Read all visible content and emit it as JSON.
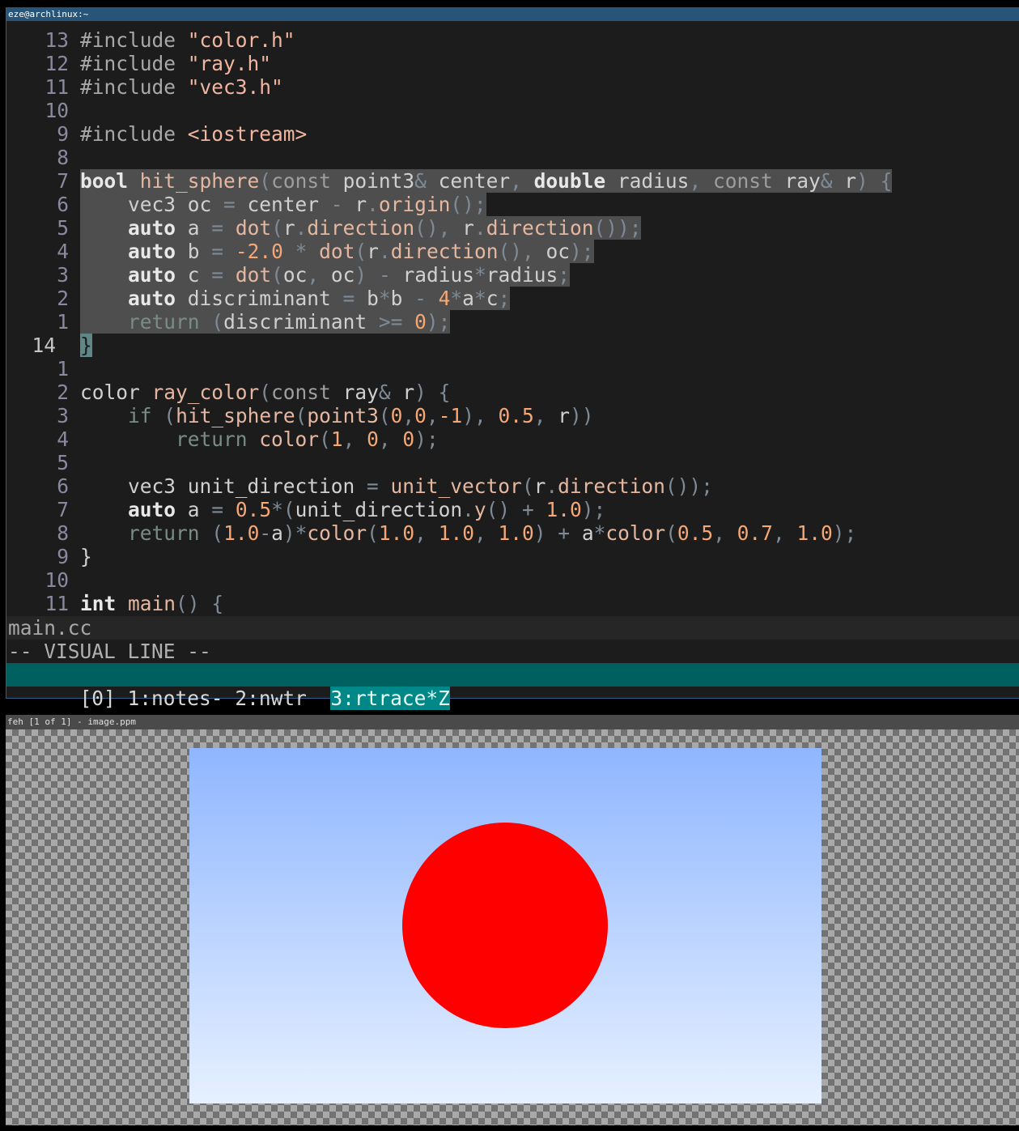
{
  "terminal": {
    "title": "eze@archlinux:~",
    "lines": [
      {
        "n": "13",
        "parts": [
          [
            "pp",
            "#include "
          ],
          [
            "st",
            "\"color.h\""
          ]
        ]
      },
      {
        "n": "12",
        "parts": [
          [
            "pp",
            "#include "
          ],
          [
            "st",
            "\"ray.h\""
          ]
        ]
      },
      {
        "n": "11",
        "parts": [
          [
            "pp",
            "#include "
          ],
          [
            "st",
            "\"vec3.h\""
          ]
        ]
      },
      {
        "n": "10",
        "parts": []
      },
      {
        "n": "9",
        "parts": [
          [
            "pp",
            "#include "
          ],
          [
            "st",
            "<iostream>"
          ]
        ]
      },
      {
        "n": "8",
        "parts": []
      },
      {
        "n": "7",
        "sel": true,
        "parts": [
          [
            "kw",
            "bool"
          ],
          [
            "txt",
            " "
          ],
          [
            "fn",
            "hit_sphere"
          ],
          [
            "op",
            "("
          ],
          [
            "ty",
            "const"
          ],
          [
            "txt",
            " point3"
          ],
          [
            "op",
            "&"
          ],
          [
            "txt",
            " center"
          ],
          [
            "op",
            ","
          ],
          [
            "txt",
            " "
          ],
          [
            "kw",
            "double"
          ],
          [
            "txt",
            " radius"
          ],
          [
            "op",
            ","
          ],
          [
            "txt",
            " "
          ],
          [
            "ty",
            "const"
          ],
          [
            "txt",
            " ray"
          ],
          [
            "op",
            "&"
          ],
          [
            "txt",
            " r"
          ],
          [
            "op",
            ")"
          ],
          [
            "txt",
            " "
          ],
          [
            "op",
            "{"
          ]
        ]
      },
      {
        "n": "6",
        "sel": true,
        "parts": [
          [
            "txt",
            "    vec3 oc "
          ],
          [
            "op",
            "="
          ],
          [
            "txt",
            " center "
          ],
          [
            "op",
            "-"
          ],
          [
            "txt",
            " r"
          ],
          [
            "op",
            "."
          ],
          [
            "fn",
            "origin"
          ],
          [
            "op",
            "();"
          ]
        ]
      },
      {
        "n": "5",
        "sel": true,
        "parts": [
          [
            "txt",
            "    "
          ],
          [
            "kw",
            "auto"
          ],
          [
            "txt",
            " a "
          ],
          [
            "op",
            "="
          ],
          [
            "txt",
            " "
          ],
          [
            "fn",
            "dot"
          ],
          [
            "op",
            "("
          ],
          [
            "txt",
            "r"
          ],
          [
            "op",
            "."
          ],
          [
            "fn",
            "direction"
          ],
          [
            "op",
            "(),"
          ],
          [
            "txt",
            " r"
          ],
          [
            "op",
            "."
          ],
          [
            "fn",
            "direction"
          ],
          [
            "op",
            "());"
          ]
        ]
      },
      {
        "n": "4",
        "sel": true,
        "parts": [
          [
            "txt",
            "    "
          ],
          [
            "kw",
            "auto"
          ],
          [
            "txt",
            " b "
          ],
          [
            "op",
            "="
          ],
          [
            "txt",
            " "
          ],
          [
            "nm",
            "-2.0"
          ],
          [
            "txt",
            " "
          ],
          [
            "op",
            "*"
          ],
          [
            "txt",
            " "
          ],
          [
            "fn",
            "dot"
          ],
          [
            "op",
            "("
          ],
          [
            "txt",
            "r"
          ],
          [
            "op",
            "."
          ],
          [
            "fn",
            "direction"
          ],
          [
            "op",
            "(),"
          ],
          [
            "txt",
            " oc"
          ],
          [
            "op",
            ");"
          ]
        ]
      },
      {
        "n": "3",
        "sel": true,
        "parts": [
          [
            "txt",
            "    "
          ],
          [
            "kw",
            "auto"
          ],
          [
            "txt",
            " c "
          ],
          [
            "op",
            "="
          ],
          [
            "txt",
            " "
          ],
          [
            "fn",
            "dot"
          ],
          [
            "op",
            "("
          ],
          [
            "txt",
            "oc"
          ],
          [
            "op",
            ","
          ],
          [
            "txt",
            " oc"
          ],
          [
            "op",
            ")"
          ],
          [
            "txt",
            " "
          ],
          [
            "op",
            "-"
          ],
          [
            "txt",
            " radius"
          ],
          [
            "op",
            "*"
          ],
          [
            "txt",
            "radius"
          ],
          [
            "op",
            ";"
          ]
        ]
      },
      {
        "n": "2",
        "sel": true,
        "parts": [
          [
            "txt",
            "    "
          ],
          [
            "kw",
            "auto"
          ],
          [
            "txt",
            " discriminant "
          ],
          [
            "op",
            "="
          ],
          [
            "txt",
            " b"
          ],
          [
            "op",
            "*"
          ],
          [
            "txt",
            "b "
          ],
          [
            "op",
            "-"
          ],
          [
            "txt",
            " "
          ],
          [
            "nm",
            "4"
          ],
          [
            "op",
            "*"
          ],
          [
            "txt",
            "a"
          ],
          [
            "op",
            "*"
          ],
          [
            "txt",
            "c"
          ],
          [
            "op",
            ";"
          ]
        ]
      },
      {
        "n": "1",
        "sel": true,
        "parts": [
          [
            "txt",
            "    "
          ],
          [
            "rt",
            "return"
          ],
          [
            "txt",
            " "
          ],
          [
            "op",
            "("
          ],
          [
            "txt",
            "discriminant "
          ],
          [
            "op",
            ">="
          ],
          [
            "txt",
            " "
          ],
          [
            "nm",
            "0"
          ],
          [
            "op",
            ");"
          ]
        ]
      },
      {
        "n": "14",
        "cur": true,
        "parts": [
          [
            "cursor",
            "}"
          ]
        ]
      },
      {
        "n": "1",
        "parts": []
      },
      {
        "n": "2",
        "parts": [
          [
            "txt",
            "color "
          ],
          [
            "fn",
            "ray_color"
          ],
          [
            "op",
            "("
          ],
          [
            "ty",
            "const"
          ],
          [
            "txt",
            " ray"
          ],
          [
            "op",
            "&"
          ],
          [
            "txt",
            " r"
          ],
          [
            "op",
            ")"
          ],
          [
            "txt",
            " "
          ],
          [
            "op",
            "{"
          ]
        ]
      },
      {
        "n": "3",
        "parts": [
          [
            "txt",
            "    "
          ],
          [
            "rt",
            "if"
          ],
          [
            "txt",
            " "
          ],
          [
            "op",
            "("
          ],
          [
            "fn",
            "hit_sphere"
          ],
          [
            "op",
            "("
          ],
          [
            "fn",
            "point3"
          ],
          [
            "op",
            "("
          ],
          [
            "nm",
            "0"
          ],
          [
            "op",
            ","
          ],
          [
            "nm",
            "0"
          ],
          [
            "op",
            ","
          ],
          [
            "nm",
            "-1"
          ],
          [
            "op",
            "),"
          ],
          [
            "txt",
            " "
          ],
          [
            "nm",
            "0.5"
          ],
          [
            "op",
            ","
          ],
          [
            "txt",
            " r"
          ],
          [
            "op",
            "))"
          ]
        ]
      },
      {
        "n": "4",
        "parts": [
          [
            "txt",
            "        "
          ],
          [
            "rt",
            "return"
          ],
          [
            "txt",
            " "
          ],
          [
            "fn",
            "color"
          ],
          [
            "op",
            "("
          ],
          [
            "nm",
            "1"
          ],
          [
            "op",
            ","
          ],
          [
            "txt",
            " "
          ],
          [
            "nm",
            "0"
          ],
          [
            "op",
            ","
          ],
          [
            "txt",
            " "
          ],
          [
            "nm",
            "0"
          ],
          [
            "op",
            ");"
          ]
        ]
      },
      {
        "n": "5",
        "parts": []
      },
      {
        "n": "6",
        "parts": [
          [
            "txt",
            "    vec3 unit_direction "
          ],
          [
            "op",
            "="
          ],
          [
            "txt",
            " "
          ],
          [
            "fn",
            "unit_vector"
          ],
          [
            "op",
            "("
          ],
          [
            "txt",
            "r"
          ],
          [
            "op",
            "."
          ],
          [
            "fn",
            "direction"
          ],
          [
            "op",
            "());"
          ]
        ]
      },
      {
        "n": "7",
        "parts": [
          [
            "txt",
            "    "
          ],
          [
            "kw",
            "auto"
          ],
          [
            "txt",
            " a "
          ],
          [
            "op",
            "="
          ],
          [
            "txt",
            " "
          ],
          [
            "nm",
            "0.5"
          ],
          [
            "op",
            "*("
          ],
          [
            "txt",
            "unit_direction"
          ],
          [
            "op",
            "."
          ],
          [
            "fn",
            "y"
          ],
          [
            "op",
            "()"
          ],
          [
            "txt",
            " "
          ],
          [
            "op",
            "+"
          ],
          [
            "txt",
            " "
          ],
          [
            "nm",
            "1.0"
          ],
          [
            "op",
            ");"
          ]
        ]
      },
      {
        "n": "8",
        "parts": [
          [
            "txt",
            "    "
          ],
          [
            "rt",
            "return"
          ],
          [
            "txt",
            " "
          ],
          [
            "op",
            "("
          ],
          [
            "nm",
            "1.0"
          ],
          [
            "op",
            "-"
          ],
          [
            "txt",
            "a"
          ],
          [
            "op",
            ")*"
          ],
          [
            "fn",
            "color"
          ],
          [
            "op",
            "("
          ],
          [
            "nm",
            "1.0"
          ],
          [
            "op",
            ","
          ],
          [
            "txt",
            " "
          ],
          [
            "nm",
            "1.0"
          ],
          [
            "op",
            ","
          ],
          [
            "txt",
            " "
          ],
          [
            "nm",
            "1.0"
          ],
          [
            "op",
            ")"
          ],
          [
            "txt",
            " "
          ],
          [
            "op",
            "+"
          ],
          [
            "txt",
            " a"
          ],
          [
            "op",
            "*"
          ],
          [
            "fn",
            "color"
          ],
          [
            "op",
            "("
          ],
          [
            "nm",
            "0.5"
          ],
          [
            "op",
            ","
          ],
          [
            "txt",
            " "
          ],
          [
            "nm",
            "0.7"
          ],
          [
            "op",
            ","
          ],
          [
            "txt",
            " "
          ],
          [
            "nm",
            "1.0"
          ],
          [
            "op",
            ");"
          ]
        ]
      },
      {
        "n": "9",
        "parts": [
          [
            "txt",
            "}"
          ]
        ]
      },
      {
        "n": "10",
        "parts": []
      },
      {
        "n": "11",
        "parts": [
          [
            "kw",
            "int"
          ],
          [
            "txt",
            " "
          ],
          [
            "fn",
            "main"
          ],
          [
            "op",
            "()"
          ],
          [
            "txt",
            " "
          ],
          [
            "op",
            "{"
          ]
        ]
      }
    ],
    "statusline": "main.cc",
    "mode": "-- VISUAL LINE --",
    "tmux": {
      "session": "[0]",
      "windows": [
        {
          "label": "1:notes-",
          "active": false
        },
        {
          "label": "2:nwtr ",
          "active": false
        },
        {
          "label": "3:rtrace*Z",
          "active": true
        }
      ]
    }
  },
  "viewer": {
    "title": "feh [1 of 1] - image.ppm",
    "sky_top": "#8fb6ff",
    "sky_bottom": "#e6f0ff",
    "sphere_color": "#ff0000"
  }
}
